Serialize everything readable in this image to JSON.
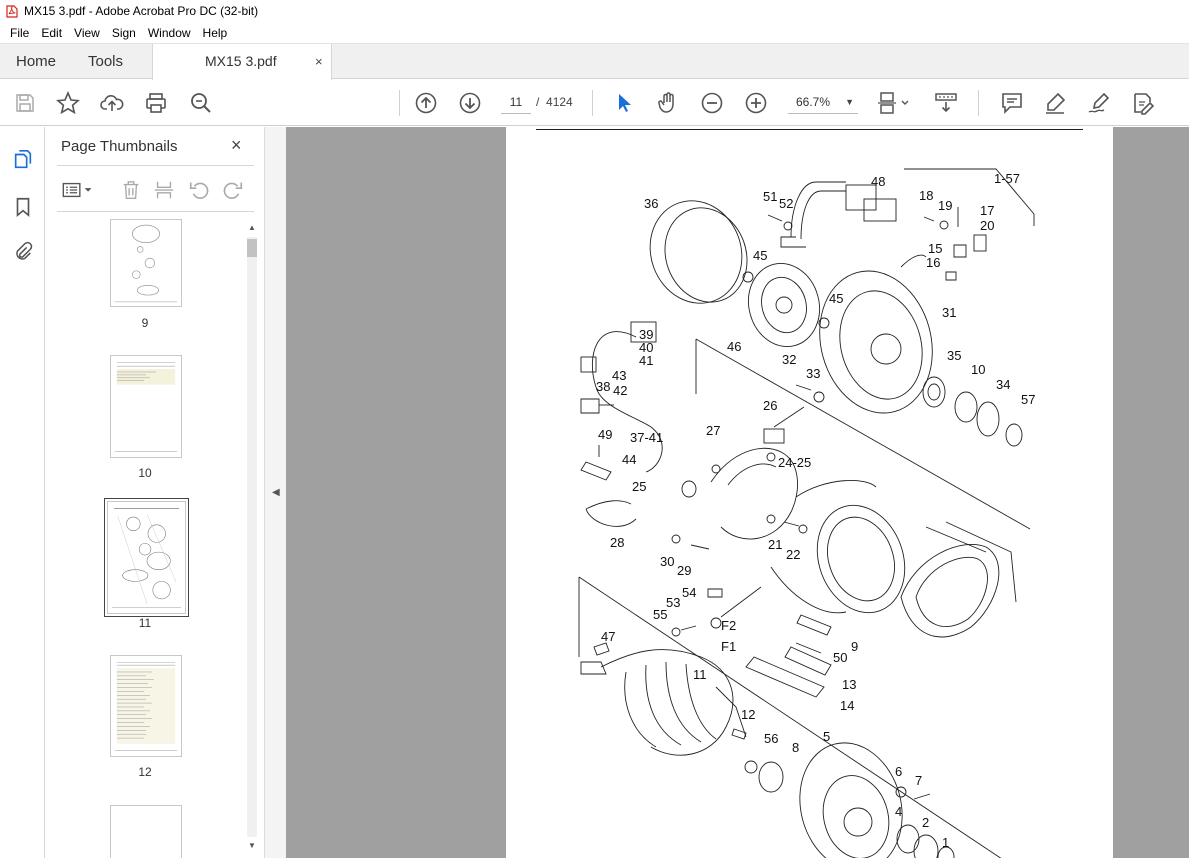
{
  "window": {
    "title": "MX15 3.pdf - Adobe Acrobat Pro DC (32-bit)"
  },
  "menu": [
    "File",
    "Edit",
    "View",
    "Sign",
    "Window",
    "Help"
  ],
  "tabs": {
    "home": "Home",
    "tools": "Tools",
    "document": "MX15 3.pdf",
    "close": "×"
  },
  "toolbar": {
    "page_current": "11",
    "page_separator": "/",
    "page_total": "4124",
    "zoom": "66.7%",
    "icons": [
      "save-icon",
      "bookmark-star-icon",
      "upload-icon",
      "print-icon",
      "zoom-search-icon",
      "page-up-icon",
      "page-down-icon",
      "select-arrow-icon",
      "hand-icon",
      "zoom-out-icon",
      "zoom-in-icon",
      "fit-page-icon",
      "scroll-mode-icon",
      "comment-icon",
      "highlight-icon",
      "sign-icon",
      "edit-pdf-icon"
    ]
  },
  "leftrail": {
    "icons": [
      "page-thumbnails-icon",
      "bookmarks-icon",
      "attachments-icon"
    ]
  },
  "thumbnails_panel": {
    "title": "Page Thumbnails",
    "close": "×",
    "pages": [
      {
        "label": "9"
      },
      {
        "label": "10"
      },
      {
        "label": "11",
        "selected": true
      },
      {
        "label": "12"
      }
    ]
  },
  "document": {
    "callouts": [
      "1-57",
      "48",
      "51",
      "52",
      "18",
      "19",
      "17",
      "20",
      "36",
      "15",
      "16",
      "45",
      "45",
      "31",
      "39",
      "40",
      "41",
      "46",
      "32",
      "33",
      "35",
      "10",
      "34",
      "57",
      "43",
      "38",
      "42",
      "37-41",
      "26",
      "49",
      "27",
      "24-25",
      "44",
      "25",
      "21",
      "22",
      "28",
      "30",
      "29",
      "54",
      "53",
      "F2",
      "55",
      "F1",
      "9",
      "47",
      "50",
      "11",
      "13",
      "14",
      "12",
      "5",
      "56",
      "8",
      "6",
      "7",
      "4",
      "2",
      "1"
    ]
  }
}
